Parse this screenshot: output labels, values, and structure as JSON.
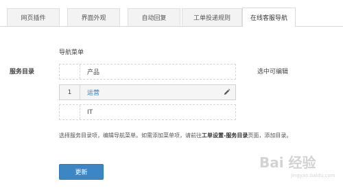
{
  "tabs": [
    {
      "label": "网页插件",
      "active": false
    },
    {
      "label": "界面外观",
      "active": false
    },
    {
      "label": "自动回复",
      "active": false
    },
    {
      "label": "工单投递规则",
      "active": false
    },
    {
      "label": "在线客服导航",
      "active": true
    }
  ],
  "form": {
    "nav_menu_label": "导航菜单",
    "service_dir_label": "服务目录",
    "hint_editable": "选中可编辑"
  },
  "menu_items": [
    {
      "index": "",
      "label": "产品",
      "selected": false
    },
    {
      "index": "1",
      "label": "运营",
      "selected": true
    },
    {
      "index": "",
      "label": "IT",
      "selected": false
    }
  ],
  "note": {
    "part1": "选择服务目录项，编辑导航菜单。如需添加菜单项，请前往",
    "link": "工单设置-服务目录",
    "part2": "页面，添加目录。"
  },
  "buttons": {
    "update_label": "更新"
  },
  "watermark": {
    "text": "Bai 经验",
    "url_text": "jingyan.baidu.com"
  },
  "colors": {
    "accent": "#3d86c6",
    "selected_text": "#2f7bc2"
  }
}
